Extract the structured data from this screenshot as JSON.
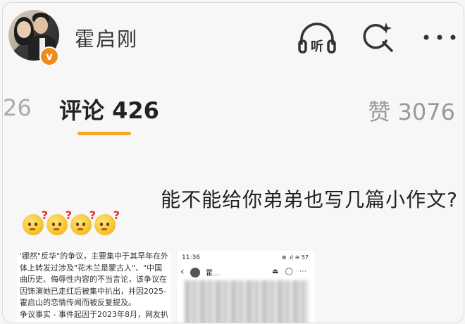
{
  "header": {
    "username": "霍启刚",
    "verified_badge": "v",
    "icons": [
      "avatar",
      "verified-icon",
      "listen-icon",
      "search-icon",
      "more-icon"
    ],
    "listen_label": "听"
  },
  "tabs": {
    "previous_partial": "26",
    "comments_label": "评论 426",
    "likes_label": "赞 3076",
    "accent_color": "#f5a623"
  },
  "comment": {
    "text": "能不能给你弟弟也写几篇小作文?",
    "emoji_count": 4,
    "emoji_icon": "puzzled-face-icon"
  },
  "attachments": {
    "document_lines": [
      "'娜然\"反华\"的争议，主要集中于其早年在外",
      "体上转发过涉及\"花木兰是蒙古人\"、\"中国",
      "曲历史、侮辱性内容的不当言论，该争议在",
      "因饰演她已走红后被集中扒出，并因2025-",
      "霍启山的恋情传闻而被反复提及。",
      "争议事实 - 事件起因于2023年8月，网友扒"
    ],
    "phone": {
      "time": "11:36",
      "status": "⊗ .ıl ≋ 57",
      "name": "霍...",
      "icons": "⏏ ◯ ⋯"
    }
  }
}
